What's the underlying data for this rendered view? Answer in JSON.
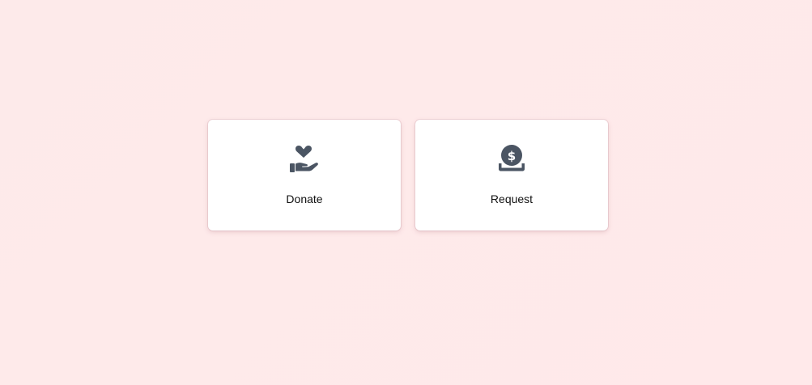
{
  "cards": [
    {
      "label": "Donate",
      "icon": "hand-holding-heart-icon"
    },
    {
      "label": "Request",
      "icon": "coin-drop-icon"
    }
  ],
  "colors": {
    "background": "#ffe9ea",
    "card": "#ffffff",
    "icon": "#4b5563",
    "text": "#111111"
  }
}
